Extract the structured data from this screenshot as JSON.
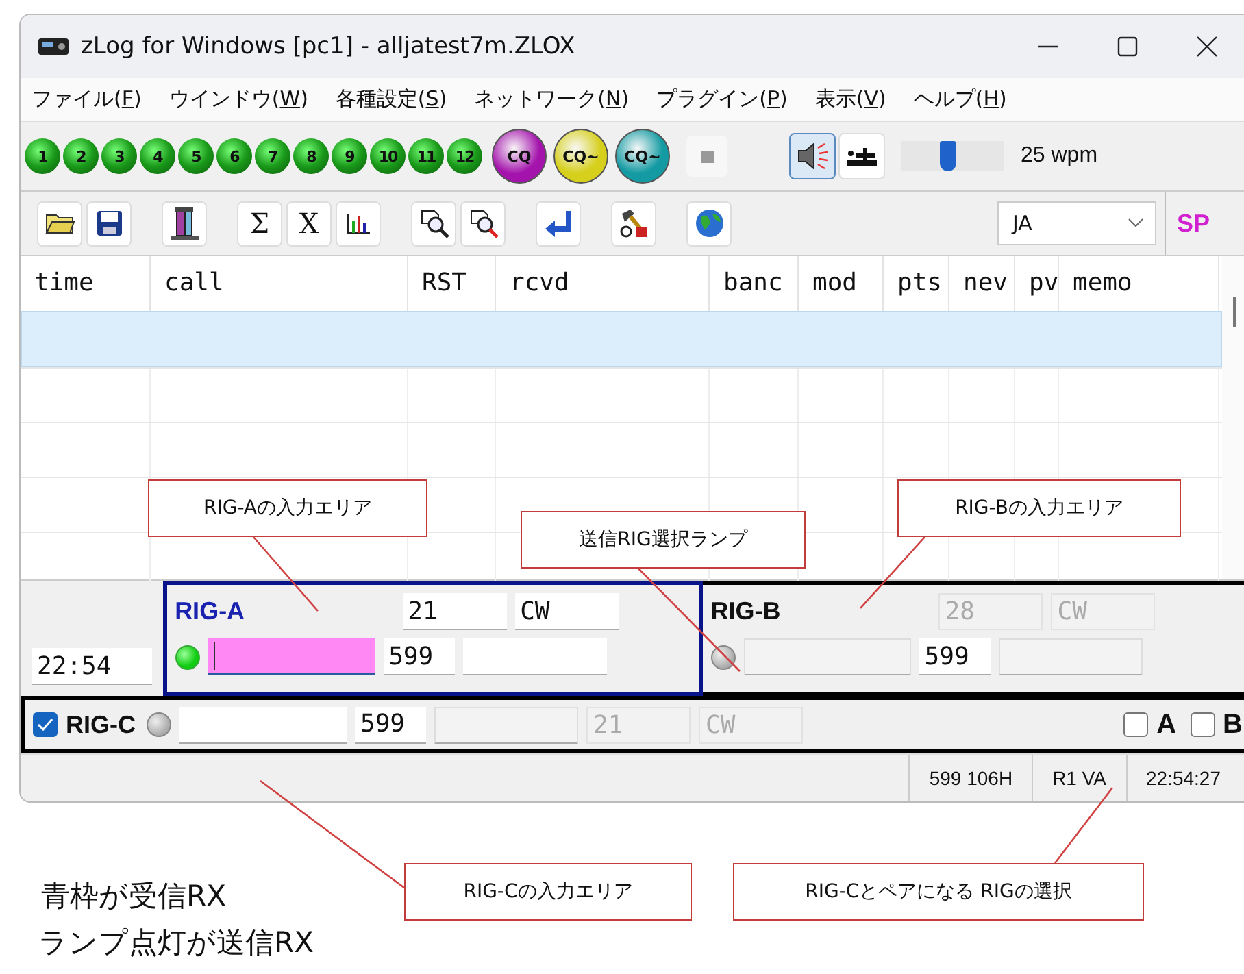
{
  "window": {
    "title": "zLog for Windows  [pc1] - alljatest7m.ZLOX"
  },
  "menu": [
    {
      "before": "ファイル(",
      "key": "F",
      "after": ")"
    },
    {
      "before": "ウインドウ(",
      "key": "W",
      "after": ")"
    },
    {
      "before": "各種設定(",
      "key": "S",
      "after": ")"
    },
    {
      "before": "ネットワーク(",
      "key": "N",
      "after": ")"
    },
    {
      "before": "プラグイン(",
      "key": "P",
      "after": ")"
    },
    {
      "before": "表示(",
      "key": "V",
      "after": ")"
    },
    {
      "before": "ヘルプ(",
      "key": "H",
      "after": ")"
    }
  ],
  "memory_buttons": [
    "1",
    "2",
    "3",
    "4",
    "5",
    "6",
    "7",
    "8",
    "9",
    "10",
    "11",
    "12"
  ],
  "cq_buttons": [
    {
      "label": "CQ",
      "color": "#a414ac"
    },
    {
      "label": "CQ~",
      "color": "#d6cf1c"
    },
    {
      "label": "CQ~",
      "color": "#139aa2"
    }
  ],
  "sidetone": {
    "selected": true
  },
  "keyer": {
    "selected": false
  },
  "speed": {
    "level": 0.45,
    "reading": "25 wpm"
  },
  "tool_groups": [
    [
      {
        "kind": "folder"
      },
      {
        "kind": "disk"
      }
    ],
    [
      {
        "kind": "tower"
      }
    ],
    [
      {
        "kind": "glyph",
        "label": "Σ"
      },
      {
        "kind": "glyph",
        "label": "X"
      },
      {
        "kind": "chart"
      }
    ],
    [
      {
        "kind": "zoom"
      },
      {
        "kind": "zoom-red"
      }
    ],
    [
      {
        "kind": "return"
      }
    ],
    [
      {
        "kind": "tools"
      }
    ],
    [
      {
        "kind": "globe"
      }
    ]
  ],
  "band_select": {
    "value": "JA"
  },
  "mode_label": "SP",
  "log": {
    "columns": [
      "time",
      "call",
      "RST",
      "rcvd",
      "banc",
      "mod",
      "pts",
      "nev",
      "pv",
      "memo"
    ],
    "rows": [
      {
        "selected": true
      },
      {
        "selected": false
      },
      {
        "selected": false
      },
      {
        "selected": false
      },
      {
        "selected": false
      }
    ]
  },
  "entry": {
    "time": "22:54",
    "rigs": [
      {
        "name": "RIG-A",
        "receive": true,
        "transmit": true,
        "call_focused": true,
        "band": "21",
        "mode": "CW",
        "rst": "599"
      },
      {
        "name": "RIG-B",
        "receive": false,
        "transmit": false,
        "call_focused": false,
        "band": "28",
        "mode": "CW",
        "rst": "599"
      }
    ],
    "rig_c": {
      "enabled": true,
      "name": "RIG-C",
      "transmit": false,
      "rst": "599",
      "band": "21",
      "mode": "CW",
      "pair": [
        {
          "label": "A",
          "checked": false
        },
        {
          "label": "B",
          "checked": false
        }
      ]
    }
  },
  "status_bar": [
    "599 106H",
    "R1 VA",
    "22:54:27"
  ],
  "callouts": [
    "RIG-Aの入力エリア",
    "送信RIG選択ランプ",
    "RIG-Bの入力エリア",
    "RIG-Cの入力エリア",
    "RIG-Cとペアになる RIGの選択"
  ],
  "notes": [
    "青枠が受信RX",
    "ランプ点灯が送信RX"
  ]
}
